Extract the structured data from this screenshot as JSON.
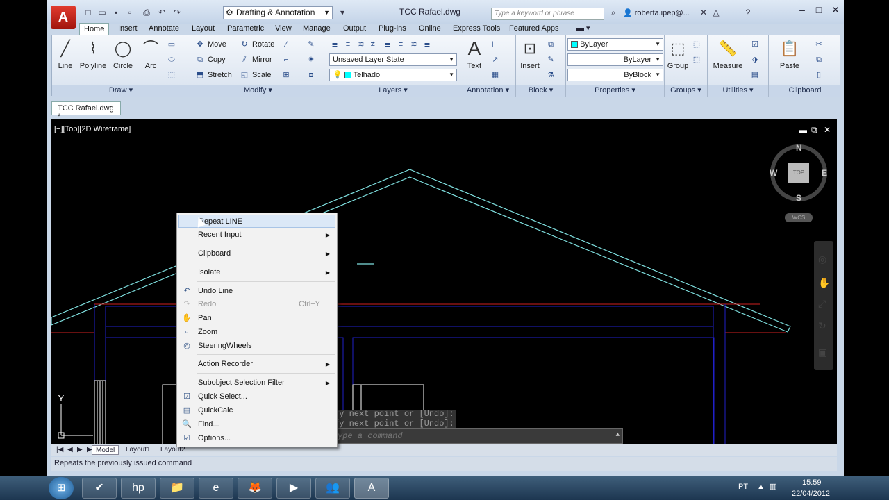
{
  "app": {
    "title": "TCC Rafael.dwg",
    "workspace": "Drafting & Annotation",
    "search_placeholder": "Type a keyword or phrase",
    "user": "roberta.ipep@...",
    "tabs": [
      "Home",
      "Insert",
      "Annotate",
      "Layout",
      "Parametric",
      "View",
      "Manage",
      "Output",
      "Plug-ins",
      "Online",
      "Express Tools",
      "Featured Apps"
    ],
    "active_tab": "Home"
  },
  "ribbon": {
    "draw": {
      "label": "Draw",
      "line": "Line",
      "polyline": "Polyline",
      "circle": "Circle",
      "arc": "Arc"
    },
    "modify": {
      "label": "Modify",
      "move": "Move",
      "copy": "Copy",
      "stretch": "Stretch",
      "rotate": "Rotate",
      "mirror": "Mirror",
      "scale": "Scale"
    },
    "layers": {
      "label": "Layers",
      "layer_state": "Unsaved Layer State",
      "current_layer": "Telhado"
    },
    "annotation": {
      "label": "Annotation",
      "text": "Text"
    },
    "block": {
      "label": "Block",
      "insert": "Insert"
    },
    "properties": {
      "label": "Properties",
      "color": "ByLayer",
      "linetype": "ByLayer",
      "lineweight": "ByBlock"
    },
    "groups": {
      "label": "Groups",
      "group": "Group"
    },
    "utilities": {
      "label": "Utilities",
      "measure": "Measure"
    },
    "clipboard": {
      "label": "Clipboard",
      "paste": "Paste"
    }
  },
  "document_tab": "TCC Rafael.dwg *",
  "viewport_label": "[−][Top][2D Wireframe]",
  "viewcube": {
    "north": "N",
    "south": "S",
    "east": "E",
    "west": "W",
    "face": "TOP",
    "ucs": "WCS"
  },
  "command_history": [
    "fy next point or [Undo]:",
    "fy next point or [Undo]:"
  ],
  "command_placeholder": "ype a command",
  "axis": {
    "y": "Y"
  },
  "layout_tabs": [
    "Model",
    "Layout1",
    "Layout2"
  ],
  "status_text": "Repeats the previously issued command",
  "context_menu": {
    "repeat": "Repeat LINE",
    "recent_input": "Recent Input",
    "clipboard": "Clipboard",
    "isolate": "Isolate",
    "undo": "Undo Line",
    "redo": "Redo",
    "redo_shortcut": "Ctrl+Y",
    "pan": "Pan",
    "zoom": "Zoom",
    "steering": "SteeringWheels",
    "action_recorder": "Action Recorder",
    "subobject": "Subobject Selection Filter",
    "quick_select": "Quick Select...",
    "quickcalc": "QuickCalc",
    "find": "Find...",
    "options": "Options..."
  },
  "taskbar": {
    "lang": "PT",
    "time": "15:59",
    "date": "22/04/2012"
  },
  "colors": {
    "roof": "#7fe0e0",
    "red_line": "#d02020",
    "blue_line": "#2020c8",
    "white": "#ffffff"
  }
}
